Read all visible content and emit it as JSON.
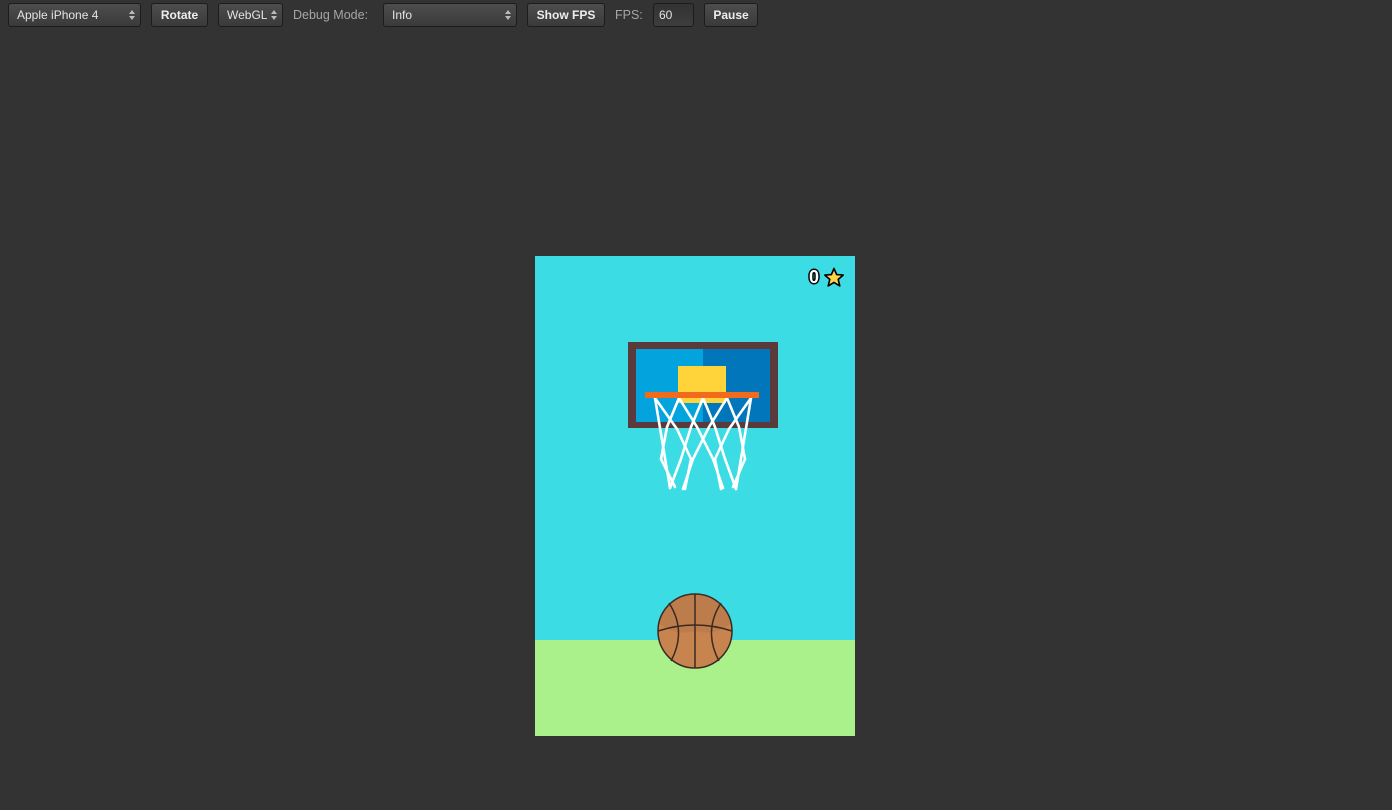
{
  "toolbar": {
    "device_select": "Apple iPhone 4",
    "rotate_label": "Rotate",
    "renderer_select": "WebGL",
    "debug_mode_label": "Debug Mode:",
    "debug_mode_select": "Info",
    "show_fps_label": "Show FPS",
    "fps_label": "FPS:",
    "fps_value": "60",
    "pause_label": "Pause"
  },
  "game": {
    "score": "0",
    "icons": {
      "score": "star-icon",
      "backboard": "backboard",
      "rim": "hoop-rim",
      "net": "net",
      "ball": "basketball"
    },
    "colors": {
      "sky": "#3cdce4",
      "ground": "#aaf18c",
      "backboard_frame": "#5a3a3a",
      "backboard_left": "#03a3dd",
      "backboard_right": "#0176ba",
      "target_square": "#ffd43b",
      "rim": "#f26b1d",
      "net": "#ffffff",
      "ball": "#c8844f",
      "star": "#ffd54a"
    }
  }
}
